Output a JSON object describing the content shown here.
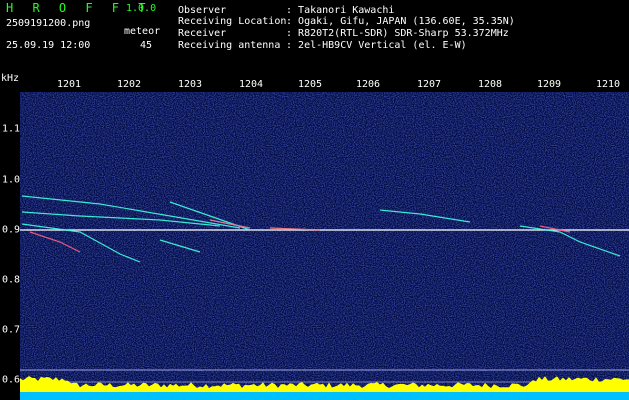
{
  "header": {
    "app_title": "H R O F F T",
    "app_version": "1.0.0",
    "file_name": "2509191200.png",
    "datetime": "25.09.19 12:00",
    "meteor_label": "meteor",
    "meteor_count": "45"
  },
  "info": {
    "observer_label": "Observer",
    "observer": "Takanori Kawachi",
    "location_label": "Receiving Location",
    "location": "Ogaki, Gifu, JAPAN (136.60E, 35.35N)",
    "receiver_label": "Receiver",
    "receiver": "R820T2(RTL-SDR) SDR-Sharp 53.372MHz",
    "antenna_label": "Receiving antenna",
    "antenna": "2el-HB9CV Vertical (el. E-W)"
  },
  "axis": {
    "unit": "kHz",
    "minute_ticks": [
      "1201",
      "1202",
      "1203",
      "1204",
      "1205",
      "1206",
      "1207",
      "1208",
      "1209",
      "1210"
    ],
    "freq_ticks": [
      "1.1",
      "1.0",
      "0.9",
      "0.8",
      "0.7",
      "0.6"
    ]
  },
  "colors": {
    "title_green": "#22ff22",
    "background": "#000620",
    "carrier": "#ffffff",
    "echo_cyan": "#40ffe0",
    "power_yellow": "#ffff00",
    "power_base": "#00c0ff"
  }
}
